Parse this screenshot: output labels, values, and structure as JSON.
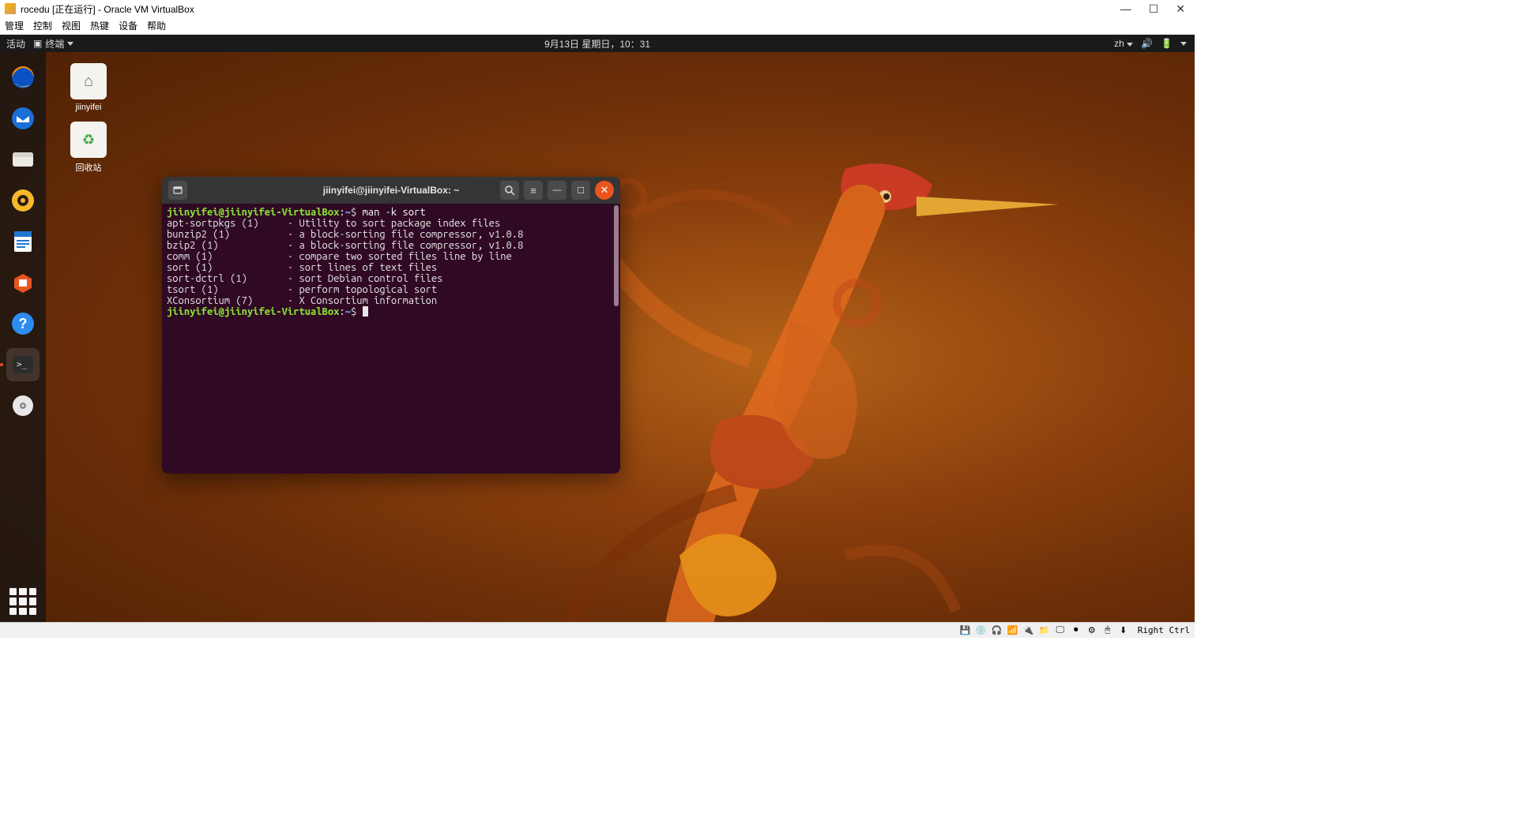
{
  "vb": {
    "title": "rocedu [正在运行] - Oracle VM VirtualBox",
    "menu": [
      "管理",
      "控制",
      "视图",
      "热键",
      "设备",
      "帮助"
    ],
    "hostkey": "Right Ctrl"
  },
  "topbar": {
    "activities": "活动",
    "app": "终端",
    "datetime": "9月13日 星期日，10：31",
    "input": "zh"
  },
  "desktop": {
    "home_label": "jiinyifei",
    "trash_label": "回收站"
  },
  "terminal": {
    "title": "jiinyifei@jiinyifei-VirtualBox: ~",
    "prompt_user": "jiinyifei@jiinyifei-VirtualBox",
    "prompt_path": "~",
    "prompt_sep": ":",
    "prompt_sym": "$",
    "command": "man -k sort",
    "lines": [
      "apt-sortpkgs (1)     - Utility to sort package index files",
      "bunzip2 (1)          - a block-sorting file compressor, v1.0.8",
      "bzip2 (1)            - a block-sorting file compressor, v1.0.8",
      "comm (1)             - compare two sorted files line by line",
      "sort (1)             - sort lines of text files",
      "sort-dctrl (1)       - sort Debian control files",
      "tsort (1)            - perform topological sort",
      "XConsortium (7)      - X Consortium information"
    ]
  }
}
